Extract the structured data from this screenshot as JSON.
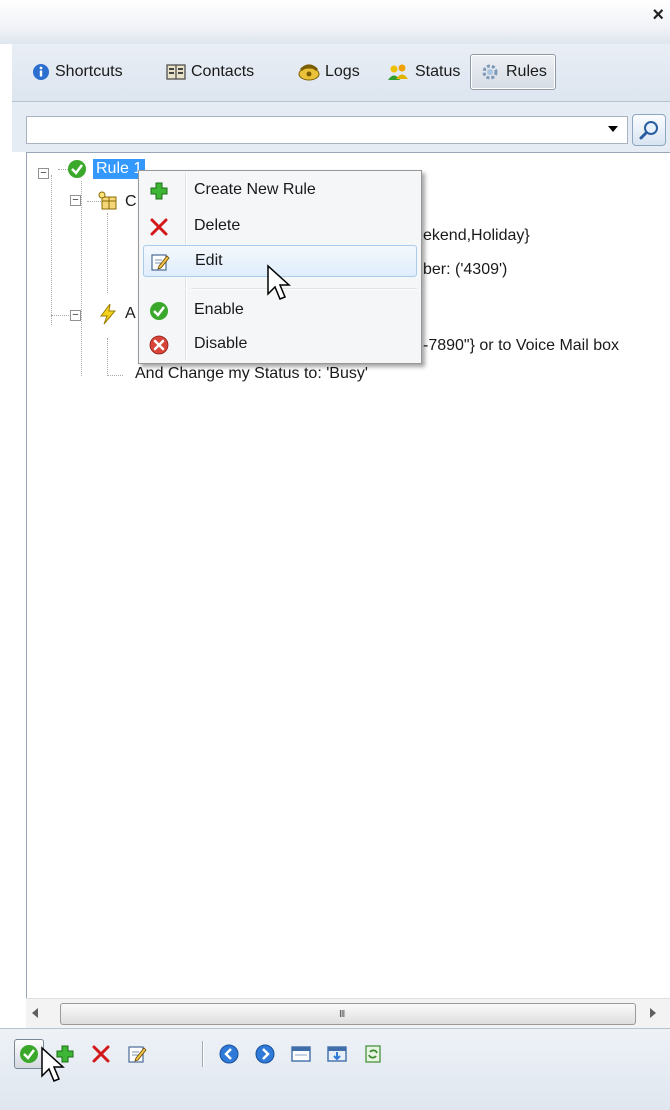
{
  "window": {
    "close_glyph": "×"
  },
  "tabs": [
    {
      "label": "Shortcuts",
      "icon": "info-icon"
    },
    {
      "label": "Contacts",
      "icon": "address-book-icon"
    },
    {
      "label": "Logs",
      "icon": "phone-log-icon"
    },
    {
      "label": "Status",
      "icon": "status-people-icon"
    },
    {
      "label": "Rules",
      "icon": "gear-icon",
      "active": true
    }
  ],
  "search": {
    "value": "",
    "placeholder": ""
  },
  "tree": {
    "rule_label": "Rule 1",
    "condition_visible": "C",
    "condition_detail_1": "ekend,Holiday}",
    "condition_detail_2": "ber: ('4309')",
    "action_visible": "A",
    "action_detail_1": "-7890\"} or to Voice Mail box",
    "action_detail_2": "And Change my Status to: 'Busy'"
  },
  "context_menu": {
    "items": [
      {
        "label": "Create New Rule",
        "icon": "plus-icon"
      },
      {
        "label": "Delete",
        "icon": "delete-x-icon"
      },
      {
        "label": "Edit",
        "icon": "edit-icon",
        "highlighted": true
      },
      {
        "label": "Enable",
        "icon": "check-circle-icon"
      },
      {
        "label": "Disable",
        "icon": "disable-circle-icon"
      }
    ]
  },
  "scrollbar": {
    "grip_glyph": "III"
  },
  "toolbar": {
    "buttons": [
      "enable-rule-icon",
      "add-rule-icon",
      "delete-rule-icon",
      "edit-rule-icon",
      "back-arrow-icon",
      "forward-arrow-icon",
      "window-icon",
      "import-icon",
      "refresh-icon"
    ]
  },
  "colors": {
    "selection": "#3399ff",
    "menu_highlight": "#dfedfb",
    "check_green": "#3aa82a",
    "delete_red": "#d21818",
    "disable_red": "#d9443a"
  }
}
